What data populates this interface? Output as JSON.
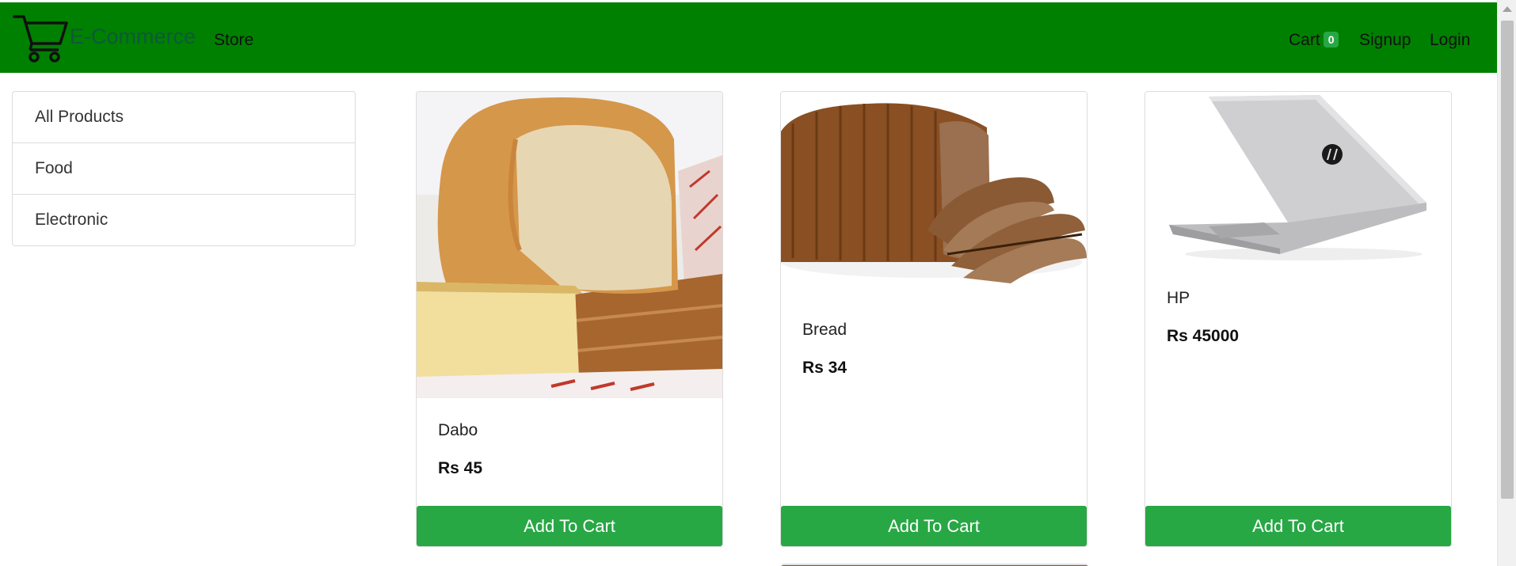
{
  "navbar": {
    "brand": "E-Commerce",
    "store_link": "Store",
    "cart_label": "Cart",
    "cart_count": "0",
    "signup_link": "Signup",
    "login_link": "Login",
    "bg_color": "#008000",
    "logo_icon": "shopping-cart-icon"
  },
  "sidebar": {
    "categories": [
      {
        "label": "All Products"
      },
      {
        "label": "Food"
      },
      {
        "label": "Electronic"
      }
    ]
  },
  "products": [
    {
      "name": "Dabo",
      "price": "Rs 45",
      "button": "Add To Cart",
      "image": "white-bread-loaf-image"
    },
    {
      "name": "Bread",
      "price": "Rs 34",
      "button": "Add To Cart",
      "image": "brown-bread-loaf-image"
    },
    {
      "name": "HP",
      "price": "Rs 45000",
      "button": "Add To Cart",
      "image": "hp-laptop-image"
    }
  ],
  "colors": {
    "button": "#28a745",
    "badge": "#28a745"
  }
}
